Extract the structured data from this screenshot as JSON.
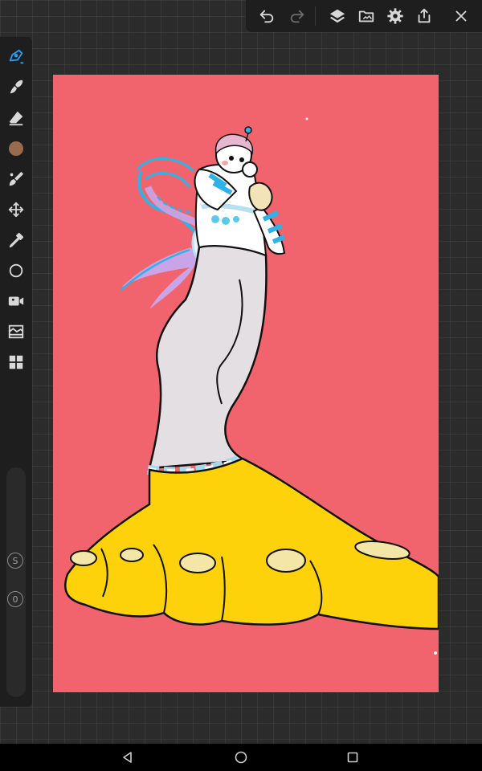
{
  "toolbar": {
    "buttons": [
      "undo-icon",
      "redo-icon",
      "layers-icon",
      "gallery-icon",
      "settings-icon",
      "share-icon",
      "close-icon"
    ]
  },
  "sidebar": {
    "tools": [
      "pen-icon",
      "smudge-icon",
      "eraser-icon",
      "color-swatch",
      "brush-icon",
      "transform-icon",
      "eyedropper-icon",
      "shape-icon",
      "video-icon",
      "adjustments-icon",
      "panels-icon"
    ],
    "current_color": "#9a6a4f",
    "size_label": "S",
    "opacity_label": "0"
  },
  "canvas": {
    "background": "#f1636d"
  },
  "navbar": {
    "buttons": [
      "back-icon",
      "home-icon",
      "recents-icon"
    ]
  }
}
